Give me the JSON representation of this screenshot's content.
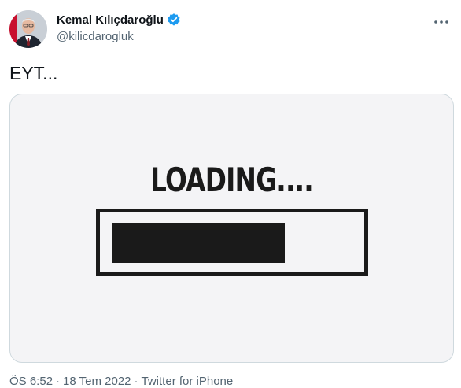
{
  "author": {
    "display_name": "Kemal Kılıçdaroğlu",
    "handle": "@kilicdarogluk",
    "verified": true
  },
  "tweet": {
    "text": "EYT...",
    "media": {
      "loading_text": "LOADING....",
      "progress": 0.72
    },
    "time": "ÖS 6:52",
    "date": "18 Tem 2022",
    "separator": "·",
    "source": "Twitter for iPhone"
  },
  "icons": {
    "verified": "verified-badge-icon",
    "more": "more-options-icon"
  },
  "colors": {
    "text_primary": "#0f1419",
    "text_secondary": "#536471",
    "verified_blue": "#1d9bf0",
    "media_bg": "#f4f4f6",
    "loading_ink": "#1a1a1a"
  }
}
